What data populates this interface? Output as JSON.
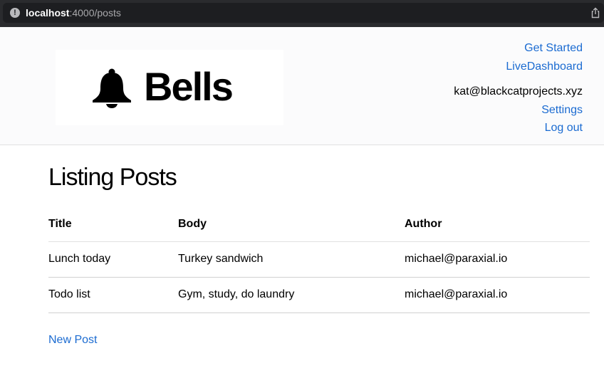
{
  "browser": {
    "url_host": "localhost",
    "url_rest": ":4000/posts"
  },
  "header": {
    "logo_text": "Bells",
    "nav": {
      "get_started": "Get Started",
      "live_dashboard": "LiveDashboard",
      "user_email": "kat@blackcatprojects.xyz",
      "settings": "Settings",
      "log_out": "Log out"
    }
  },
  "main": {
    "title": "Listing Posts",
    "columns": [
      "Title",
      "Body",
      "Author"
    ],
    "rows": [
      {
        "title": "Lunch today",
        "body": "Turkey sandwich",
        "author": "michael@paraxial.io"
      },
      {
        "title": "Todo list",
        "body": "Gym, study, do laundry",
        "author": "michael@paraxial.io"
      }
    ],
    "new_post": "New Post"
  },
  "colors": {
    "link": "#1b6bd1",
    "urlbar": "#1d1e21"
  }
}
